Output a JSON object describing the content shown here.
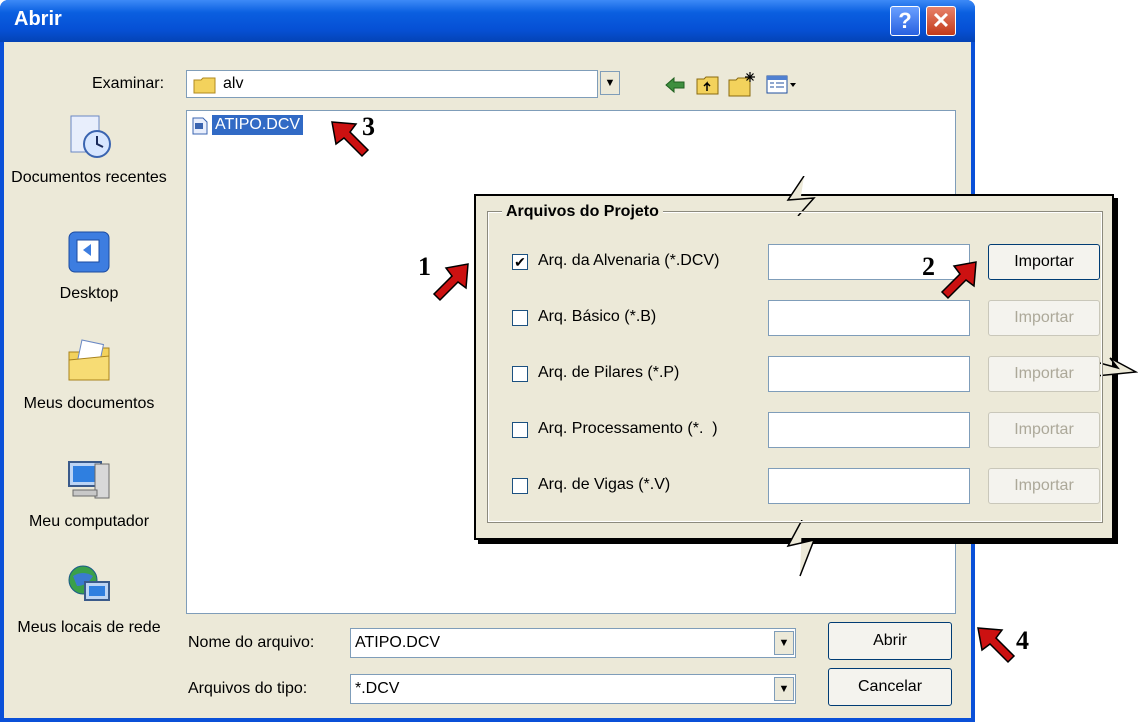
{
  "dialog": {
    "title": "Abrir",
    "help_glyph": "?",
    "close_glyph": "✕",
    "look_in_label": "Examinar:",
    "look_in_value": "alv",
    "filename_label": "Nome do arquivo:",
    "filename_value": "ATIPO.DCV",
    "filetype_label": "Arquivos do tipo:",
    "filetype_value": "*.DCV",
    "open_button": "Abrir",
    "cancel_button": "Cancelar",
    "files": [
      {
        "name": "ATIPO.DCV",
        "selected": true
      }
    ]
  },
  "places": [
    {
      "label": "Documentos recentes",
      "icon": "recent-documents-icon"
    },
    {
      "label": "Desktop",
      "icon": "desktop-icon"
    },
    {
      "label": "Meus documentos",
      "icon": "my-documents-icon"
    },
    {
      "label": "Meu computador",
      "icon": "my-computer-icon"
    },
    {
      "label": "Meus locais de rede",
      "icon": "network-places-icon"
    }
  ],
  "project_panel": {
    "title": "Arquivos do Projeto",
    "rows": [
      {
        "label": "Arq. da Alvenaria (*.DCV)",
        "checked": true,
        "button": "Importar",
        "enabled": true
      },
      {
        "label": "Arq. Básico (*.B)",
        "checked": false,
        "button": "Importar",
        "enabled": false
      },
      {
        "label": "Arq. de Pilares (*.P)",
        "checked": false,
        "button": "Importar",
        "enabled": false
      },
      {
        "label": "Arq. Processamento (*.  )",
        "checked": false,
        "button": "Importar",
        "enabled": false
      },
      {
        "label": "Arq. de Vigas (*.V)",
        "checked": false,
        "button": "Importar",
        "enabled": false
      }
    ]
  },
  "annotations": [
    "1",
    "2",
    "3",
    "4"
  ],
  "colors": {
    "titlebar": "#0a5fe0",
    "dialog_bg": "#ece9d8",
    "selection": "#316ac5",
    "arrow": "#cc1111"
  }
}
